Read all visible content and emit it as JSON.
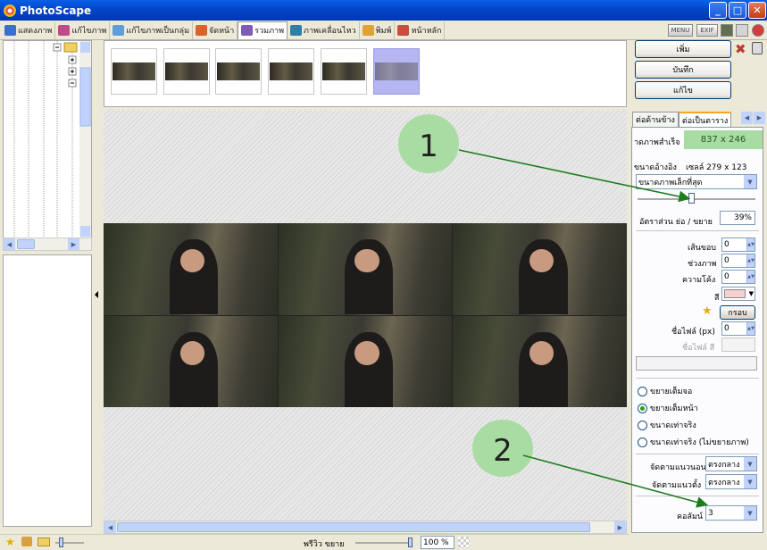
{
  "window": {
    "title": "PhotoScape",
    "minimize": "_",
    "maximize": "□",
    "close": "✕"
  },
  "menu": {
    "tabs": [
      {
        "label": "แสดงภาพ",
        "color": "#3b6fc9"
      },
      {
        "label": "แก้ไขภาพ",
        "color": "#c14a8a"
      },
      {
        "label": "แก้ไขภาพเป็นกลุ่ม",
        "color": "#5aa0d8"
      },
      {
        "label": "จัดหน้า",
        "color": "#d9642b"
      },
      {
        "label": "รวมภาพ",
        "color": "#7e5bb7"
      },
      {
        "label": "ภาพเคลื่อนไหว",
        "color": "#2f7ea6"
      },
      {
        "label": "พิมพ์",
        "color": "#e0a234"
      },
      {
        "label": "หน้าหลัก",
        "color": "#c94e3b"
      }
    ],
    "active_index": 4,
    "menu_button": "MENU",
    "exif_button": "EXIF"
  },
  "preview": {
    "label": "พรีวิว ขยาย",
    "zoom": "100 %"
  },
  "right": {
    "add_button": "เพิ่ม",
    "save_button": "บันทึก",
    "edit_button": "แก้ไข",
    "tabs": [
      "ต่อด้านข้าง",
      "ต่อเป็นตาราง"
    ],
    "active_tab": 1,
    "result_size_label": "าดภาพสำเร็จ",
    "result_size_value": "837 x 246",
    "ref_size_label": "ขนาดอ้างอิง",
    "ref_size_value": "เซลล์ 279 x 123",
    "size_mode": "ขนาดภาพเล็กที่สุด",
    "ratio_label": "อัตราส่วน ย่อ / ขยาย",
    "ratio_value": "39%",
    "border_label": "เส้นขอบ",
    "border_value": "0",
    "gap_label": "ช่วงภาพ",
    "gap_value": "0",
    "curve_label": "ความโค้ง",
    "curve_value": "0",
    "color_label": "สี",
    "frame_button": "กรอบ",
    "font_label": "ชื่อไฟล์ (px)",
    "font_value": "0",
    "font_color_label": "ชื่อไฟล์ สี",
    "radios": [
      "ขยายเต็มจอ",
      "ขยายเต็มหน้า",
      "ขนาดเท่าจริง",
      "ขนาดเท่าจริง (ไม่ขยายภาพ)"
    ],
    "radio_selected": 1,
    "halign_label": "จัดตามแนวนอน",
    "halign_value": "ตรงกลาง",
    "valign_label": "จัดตามแนวตั้ง",
    "valign_value": "ตรงกลาง",
    "columns_label": "คอลัมน์",
    "columns_value": "3"
  },
  "annotations": [
    {
      "label": "1",
      "color": "#a9dca2"
    },
    {
      "label": "2",
      "color": "#a9dca2"
    }
  ]
}
